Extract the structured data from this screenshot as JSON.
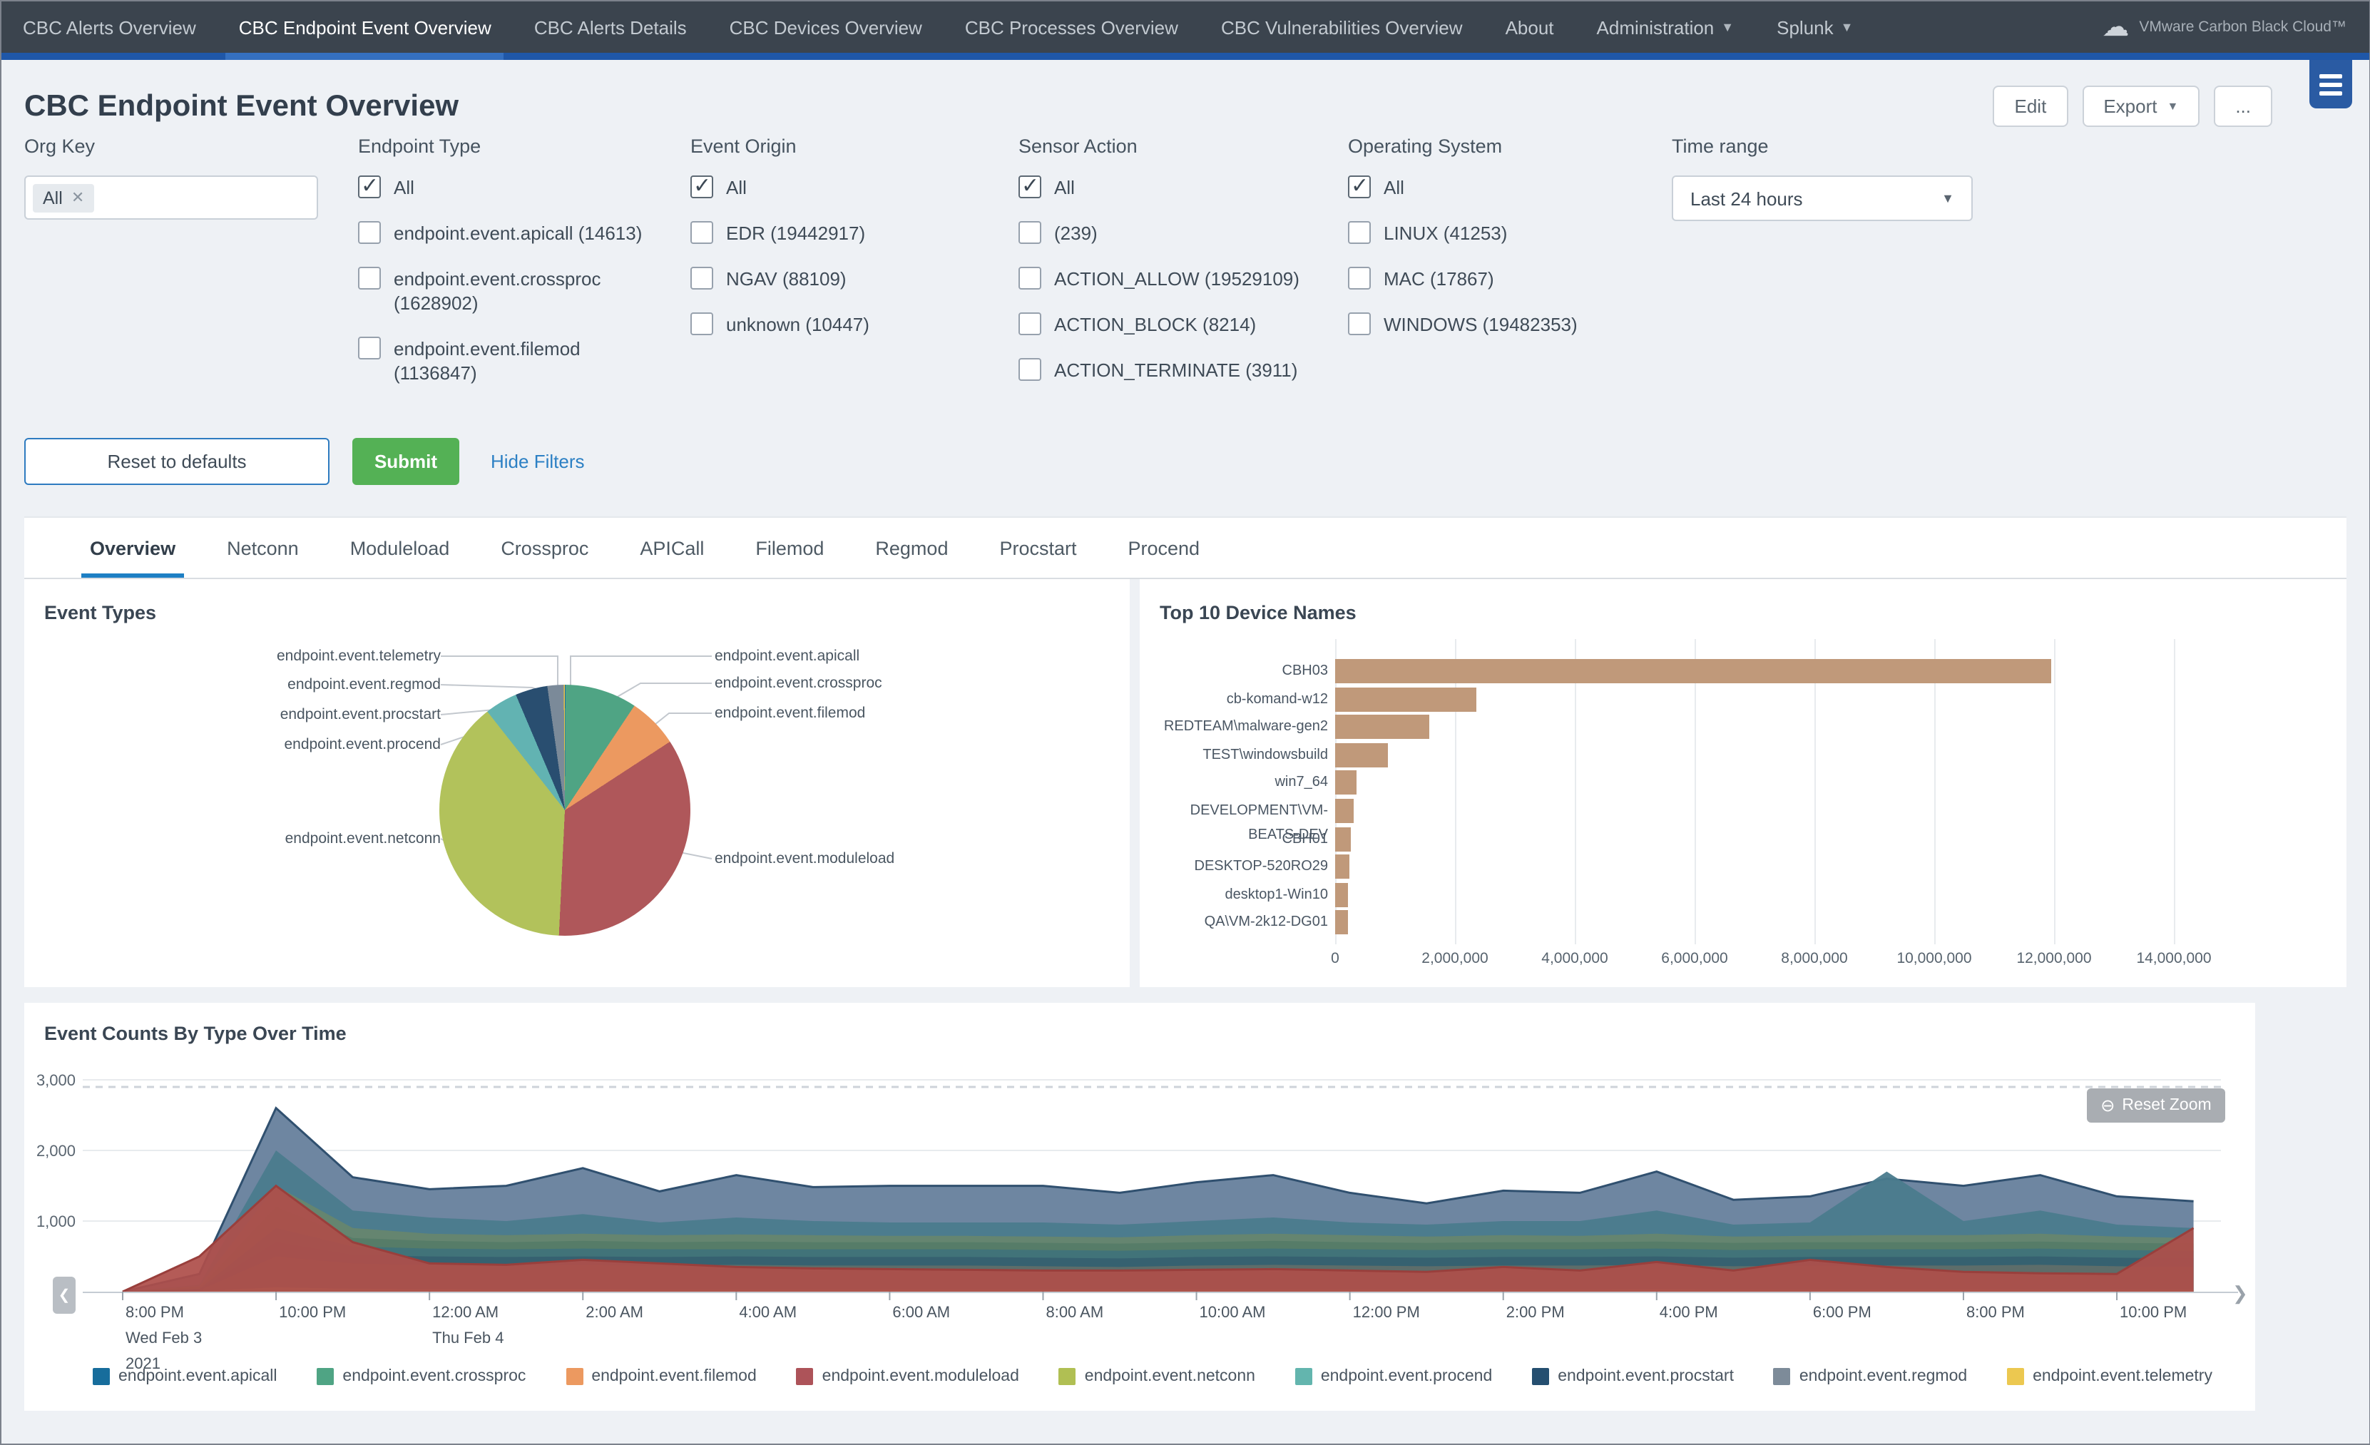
{
  "nav": {
    "tabs": [
      {
        "label": "CBC Alerts Overview",
        "active": false,
        "caret": false
      },
      {
        "label": "CBC Endpoint Event Overview",
        "active": true,
        "caret": false
      },
      {
        "label": "CBC Alerts Details",
        "active": false,
        "caret": false
      },
      {
        "label": "CBC Devices Overview",
        "active": false,
        "caret": false
      },
      {
        "label": "CBC Processes Overview",
        "active": false,
        "caret": false
      },
      {
        "label": "CBC Vulnerabilities Overview",
        "active": false,
        "caret": false
      },
      {
        "label": "About",
        "active": false,
        "caret": false
      },
      {
        "label": "Administration",
        "active": false,
        "caret": true
      },
      {
        "label": "Splunk",
        "active": false,
        "caret": true
      }
    ],
    "brand": "VMware Carbon Black Cloud™"
  },
  "header": {
    "title": "CBC Endpoint Event Overview",
    "edit_label": "Edit",
    "export_label": "Export",
    "more_label": "..."
  },
  "filters": {
    "org_key": {
      "label": "Org Key",
      "chip": "All"
    },
    "groups": [
      {
        "label": "Endpoint Type",
        "items": [
          {
            "label": "All",
            "checked": true
          },
          {
            "label": "endpoint.event.apicall (14613)",
            "checked": false
          },
          {
            "label": "endpoint.event.crossproc (1628902)",
            "checked": false
          },
          {
            "label": "endpoint.event.filemod (1136847)",
            "checked": false
          }
        ]
      },
      {
        "label": "Event Origin",
        "items": [
          {
            "label": "All",
            "checked": true
          },
          {
            "label": "EDR (19442917)",
            "checked": false
          },
          {
            "label": "NGAV (88109)",
            "checked": false
          },
          {
            "label": "unknown (10447)",
            "checked": false
          }
        ]
      },
      {
        "label": "Sensor Action",
        "items": [
          {
            "label": "All",
            "checked": true
          },
          {
            "label": "(239)",
            "checked": false
          },
          {
            "label": "ACTION_ALLOW (19529109)",
            "checked": false
          },
          {
            "label": "ACTION_BLOCK (8214)",
            "checked": false
          },
          {
            "label": "ACTION_TERMINATE (3911)",
            "checked": false
          }
        ]
      },
      {
        "label": "Operating System",
        "items": [
          {
            "label": "All",
            "checked": true
          },
          {
            "label": "LINUX (41253)",
            "checked": false
          },
          {
            "label": "MAC (17867)",
            "checked": false
          },
          {
            "label": "WINDOWS (19482353)",
            "checked": false
          }
        ]
      }
    ],
    "time_range": {
      "label": "Time range",
      "value": "Last 24 hours"
    }
  },
  "actions": {
    "reset": "Reset to defaults",
    "submit": "Submit",
    "hide_filters": "Hide Filters"
  },
  "content_tabs": {
    "items": [
      "Overview",
      "Netconn",
      "Moduleload",
      "Crossproc",
      "APICall",
      "Filemod",
      "Regmod",
      "Procstart",
      "Procend"
    ],
    "active_index": 0
  },
  "chart_data": [
    {
      "id": "event_types",
      "type": "pie",
      "title": "Event Types",
      "slices": [
        {
          "name": "endpoint.event.apicall",
          "value": 14613,
          "color": "#1f6e9c"
        },
        {
          "name": "endpoint.event.crossproc",
          "value": 1628902,
          "color": "#4fa484"
        },
        {
          "name": "endpoint.event.filemod",
          "value": 1136847,
          "color": "#ec9960"
        },
        {
          "name": "endpoint.event.moduleload",
          "value": 6150000,
          "color": "#af575a"
        },
        {
          "name": "endpoint.event.netconn",
          "value": 6800000,
          "color": "#b2c25b"
        },
        {
          "name": "endpoint.event.procend",
          "value": 740000,
          "color": "#62b3b2"
        },
        {
          "name": "endpoint.event.procstart",
          "value": 730000,
          "color": "#294e70"
        },
        {
          "name": "endpoint.event.regmod",
          "value": 370000,
          "color": "#7b8a99"
        },
        {
          "name": "endpoint.event.telemetry",
          "value": 25000,
          "color": "#e9c344"
        }
      ]
    },
    {
      "id": "top_devices",
      "type": "bar",
      "title": "Top 10 Device Names",
      "categories": [
        "CBH03",
        "cb-komand-w12",
        "REDTEAM\\malware-gen2",
        "TEST\\windowsbuild",
        "win7_64",
        "DEVELOPMENT\\VM-BEATS-DEV",
        "CBH01",
        "DESKTOP-520RO29",
        "desktop1-Win10",
        "QA\\VM-2k12-DG01"
      ],
      "values": [
        11950000,
        2350000,
        1560000,
        870000,
        360000,
        300000,
        250000,
        240000,
        220000,
        210000
      ],
      "bar_color": "#c0997a",
      "xlim": [
        0,
        14000000
      ],
      "x_tick_labels": [
        "0",
        "2,000,000",
        "4,000,000",
        "6,000,000",
        "8,000,000",
        "10,000,000",
        "12,000,000",
        "14,000,000"
      ]
    },
    {
      "id": "events_over_time",
      "type": "area",
      "title": "Event Counts By Type Over Time",
      "reset_zoom_label": "Reset Zoom",
      "ylim": [
        0,
        3000
      ],
      "y_tick_labels": [
        "1,000",
        "2,000",
        "3,000"
      ],
      "x_tick_labels": [
        "8:00 PM",
        "10:00 PM",
        "12:00 AM",
        "2:00 AM",
        "4:00 AM",
        "6:00 AM",
        "8:00 AM",
        "10:00 AM",
        "12:00 PM",
        "2:00 PM",
        "4:00 PM",
        "6:00 PM",
        "8:00 PM",
        "10:00 PM"
      ],
      "x_sub_labels": [
        {
          "tick_index": 0,
          "lines": [
            "Wed Feb 3",
            "2021"
          ]
        },
        {
          "tick_index": 2,
          "lines": [
            "Thu Feb 4"
          ]
        }
      ],
      "series": [
        {
          "name": "endpoint.event.apicall",
          "color": "#176d9c",
          "area_color": "#28688e",
          "area_opacity": 0.45,
          "values": [
            0,
            40,
            900,
            640,
            610,
            600,
            610,
            600,
            600,
            600,
            600,
            600,
            590,
            580,
            600,
            610,
            600,
            590,
            600,
            600,
            610,
            590,
            600,
            600,
            600,
            610,
            590,
            580
          ]
        },
        {
          "name": "endpoint.event.crossproc",
          "color": "#4fa484",
          "area_color": "#47745f",
          "area_opacity": 0.5,
          "values": [
            0,
            60,
            1200,
            760,
            720,
            700,
            720,
            700,
            710,
            700,
            700,
            700,
            690,
            680,
            700,
            720,
            700,
            690,
            700,
            700,
            710,
            690,
            700,
            700,
            700,
            710,
            690,
            680
          ]
        },
        {
          "name": "endpoint.event.filemod",
          "color": "#ec9960",
          "area_color": "#b98a5e",
          "area_opacity": 0.3,
          "values": [
            0,
            20,
            500,
            400,
            380,
            370,
            380,
            370,
            380,
            370,
            370,
            370,
            360,
            350,
            370,
            380,
            370,
            360,
            370,
            370,
            380,
            360,
            370,
            370,
            370,
            380,
            360,
            350
          ]
        },
        {
          "name": "endpoint.event.moduleload",
          "color": "#ad5359",
          "area_color": "#ae4f4a",
          "area_opacity": 0.93,
          "stroke": "#993f3c",
          "values": [
            0,
            500,
            1500,
            700,
            400,
            380,
            450,
            400,
            350,
            330,
            320,
            310,
            300,
            300,
            310,
            320,
            300,
            280,
            350,
            300,
            420,
            300,
            450,
            350,
            280,
            260,
            250,
            900
          ]
        },
        {
          "name": "endpoint.event.netconn",
          "color": "#b0bf53",
          "area_color": "#7d8d52",
          "area_opacity": 0.5,
          "values": [
            0,
            80,
            1500,
            900,
            820,
            800,
            820,
            800,
            810,
            800,
            790,
            790,
            780,
            770,
            800,
            820,
            800,
            780,
            800,
            790,
            820,
            780,
            790,
            800,
            800,
            820,
            780,
            760
          ]
        },
        {
          "name": "endpoint.event.procend",
          "color": "#63b5ae",
          "area_color": "#4a7b8d",
          "area_opacity": 0.95,
          "values": [
            0,
            100,
            2000,
            1150,
            1050,
            1000,
            1100,
            980,
            1050,
            1000,
            980,
            980,
            980,
            950,
            1000,
            1050,
            980,
            950,
            1000,
            1000,
            1150,
            950,
            980,
            1700,
            1000,
            1150,
            950,
            900
          ]
        },
        {
          "name": "endpoint.event.procstart",
          "color": "#254f70",
          "area_color": "#2b4c67",
          "area_opacity": 0.45,
          "values": [
            0,
            30,
            700,
            520,
            500,
            490,
            500,
            490,
            500,
            490,
            490,
            490,
            480,
            470,
            490,
            500,
            490,
            480,
            490,
            490,
            500,
            480,
            490,
            490,
            490,
            500,
            480,
            470
          ]
        },
        {
          "name": "endpoint.event.regmod",
          "color": "#7d8b99",
          "area_color": "#6e86a1",
          "area_opacity": 1.0,
          "stroke": "#30506f",
          "values": [
            0,
            250,
            2600,
            1620,
            1450,
            1500,
            1750,
            1420,
            1650,
            1480,
            1500,
            1500,
            1500,
            1400,
            1550,
            1650,
            1400,
            1250,
            1430,
            1400,
            1700,
            1300,
            1350,
            1600,
            1500,
            1650,
            1350,
            1280
          ]
        },
        {
          "name": "endpoint.event.telemetry",
          "color": "#ecc850",
          "area_color": "#d9c258",
          "area_opacity": 0.5,
          "values": [
            0,
            10,
            60,
            40,
            35,
            30,
            35,
            30,
            30,
            30,
            30,
            30,
            30,
            30,
            30,
            30,
            30,
            30,
            30,
            30,
            35,
            30,
            30,
            30,
            30,
            30,
            30,
            30
          ]
        }
      ]
    }
  ]
}
